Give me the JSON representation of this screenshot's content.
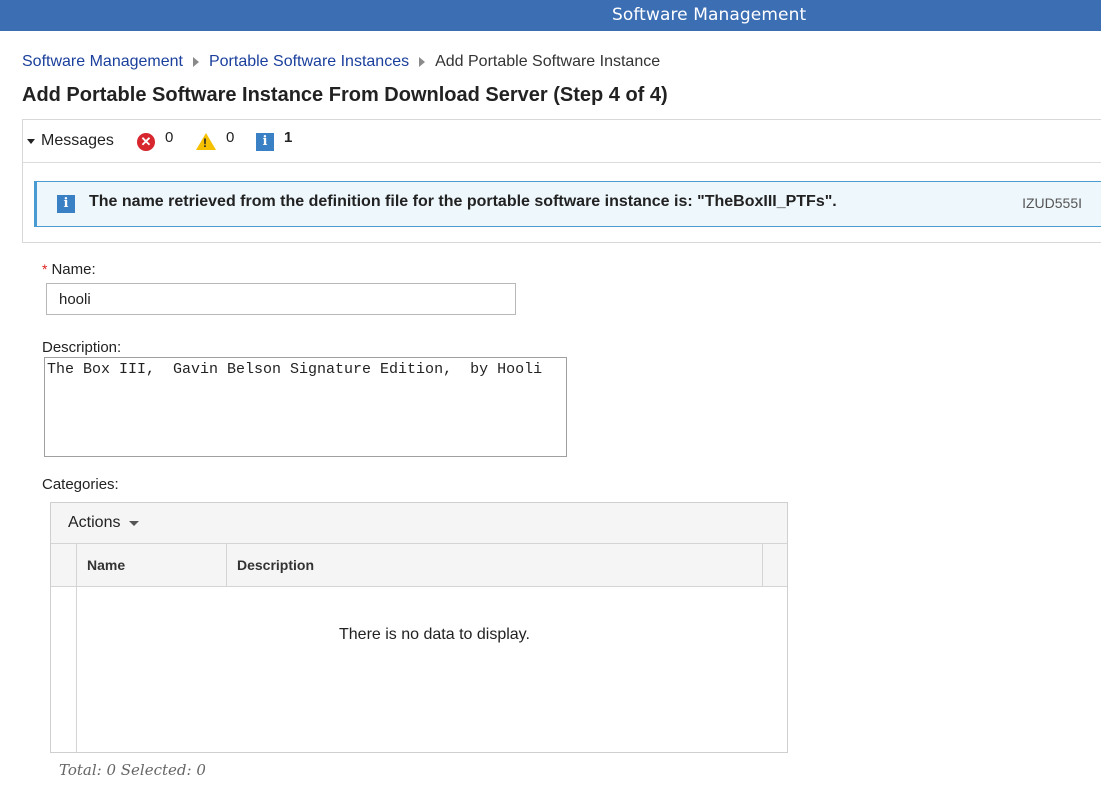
{
  "app": {
    "title": "Software Management"
  },
  "breadcrumb": {
    "items": [
      "Software Management",
      "Portable Software Instances"
    ],
    "current": "Add Portable Software Instance"
  },
  "page": {
    "title": "Add Portable Software Instance From Download Server (Step 4 of 4)"
  },
  "messages": {
    "toggle_label": "Messages",
    "error_count": "0",
    "warning_count": "0",
    "info_count": "1",
    "error_icon": "error-icon",
    "warning_icon": "warning-icon",
    "info_icon": "info-icon",
    "info_text": "The name retrieved from the definition file for the portable software instance is: \"TheBoxIII_PTFs\".",
    "info_id": "IZUD555I"
  },
  "form": {
    "name_label": "Name:",
    "name_required_marker": "*",
    "name_value": "hooli",
    "description_label": "Description:",
    "description_value": "The Box III,  Gavin Belson Signature Edition,  by Hooli",
    "categories_label": "Categories:"
  },
  "grid": {
    "actions_label": "Actions",
    "columns": [
      "Name",
      "Description"
    ],
    "empty_text": "There is no data to display.",
    "footer": "Total: 0 Selected: 0"
  },
  "colors": {
    "header": "#3c6eb4",
    "link": "#1a3f9c",
    "info": "#3a80c4",
    "error": "#d7262d",
    "warning": "#f5c000"
  }
}
